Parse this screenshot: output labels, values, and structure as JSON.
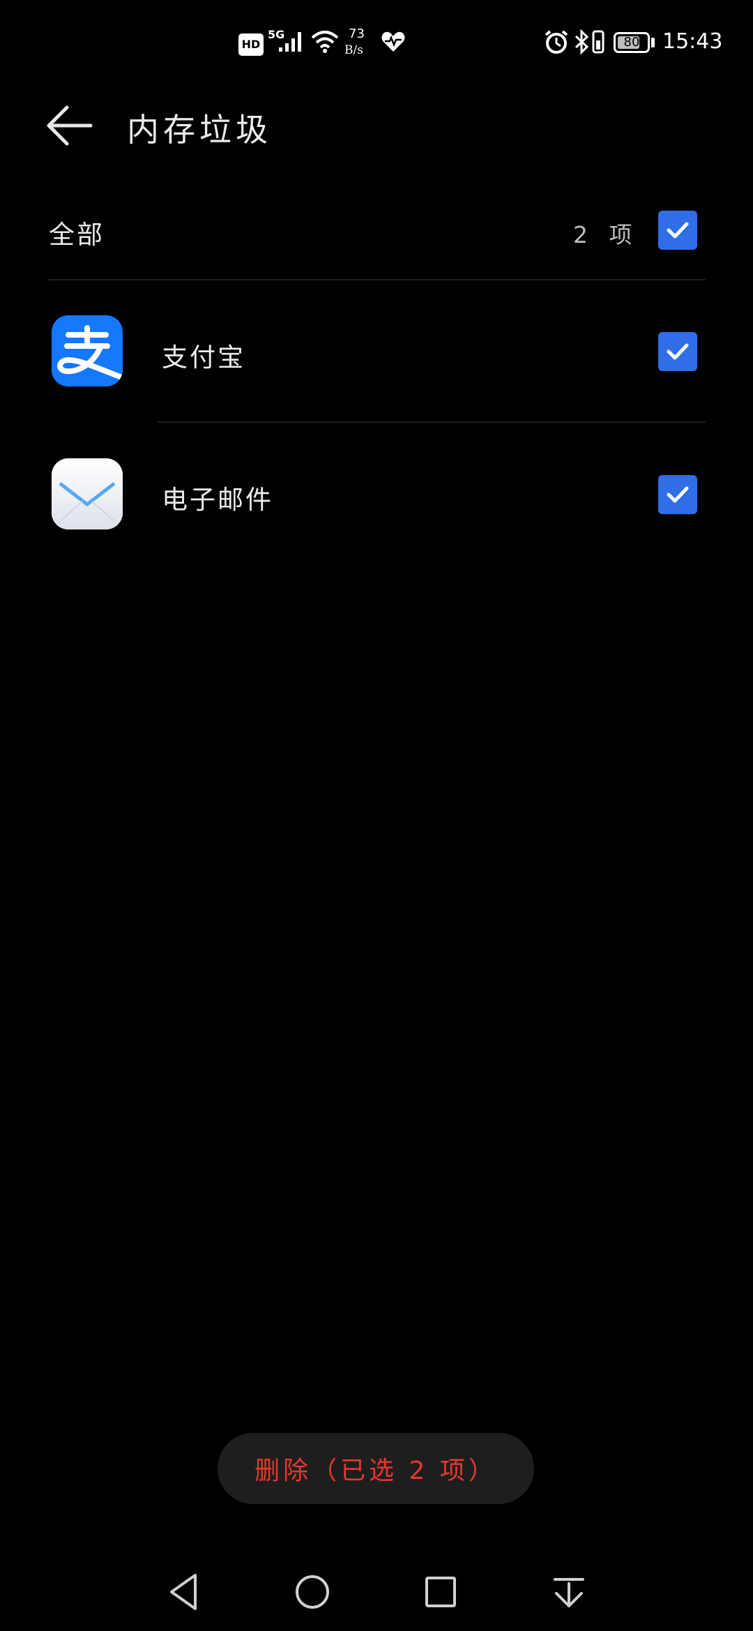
{
  "status_bar": {
    "hd": "HD",
    "network": "5G",
    "speed_value": "73",
    "speed_unit": "B/s",
    "battery_percent": 80,
    "battery_label": "80",
    "time": "15:43",
    "icons": [
      "hd-icon",
      "signal-icon",
      "wifi-icon",
      "heart-health-icon",
      "alarm-icon",
      "bluetooth-icon",
      "vibrate-icon",
      "battery-icon"
    ]
  },
  "header": {
    "title": "内存垃圾",
    "back_icon": "arrow-left-icon"
  },
  "select_all": {
    "label": "全部",
    "count": "2 项",
    "checked": true
  },
  "apps": [
    {
      "name": "支付宝",
      "icon": "alipay-icon",
      "checked": true
    },
    {
      "name": "电子邮件",
      "icon": "email-icon",
      "checked": true
    }
  ],
  "delete_button": {
    "label": "删除（已选 2 项）"
  },
  "nav_bar": {
    "icons": [
      "nav-back-icon",
      "nav-home-icon",
      "nav-recent-icon",
      "nav-notification-icon"
    ]
  },
  "colors": {
    "accent": "#2f6ee6",
    "danger": "#e5382f",
    "background": "#000000",
    "button_bg": "#1e1e1e"
  }
}
